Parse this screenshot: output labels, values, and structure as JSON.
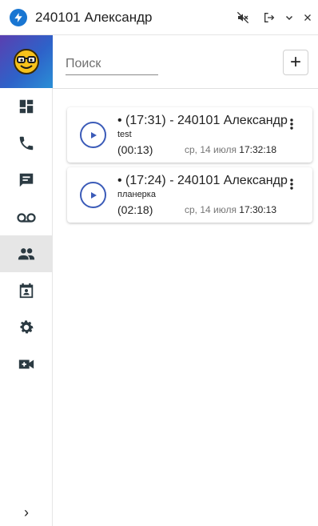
{
  "window": {
    "title": "240101 Александр",
    "icons": [
      "app-bolt-icon",
      "mute-icon",
      "logout-icon",
      "chevron-down-icon",
      "close-icon"
    ]
  },
  "sidebar": {
    "avatar": "glasses-emoji-avatar",
    "items": [
      {
        "icon": "dashboard-icon",
        "active": false
      },
      {
        "icon": "phone-icon",
        "active": false
      },
      {
        "icon": "chat-icon",
        "active": false
      },
      {
        "icon": "voicemail-icon",
        "active": false
      },
      {
        "icon": "people-icon",
        "active": true
      },
      {
        "icon": "calendar-person-icon",
        "active": false
      },
      {
        "icon": "gear-icon",
        "active": false
      },
      {
        "icon": "video-add-icon",
        "active": false
      }
    ],
    "expand_label": "›"
  },
  "main": {
    "search_placeholder": "Поиск",
    "add_label": "+",
    "recordings": [
      {
        "title": "• (17:31) - 240101 Александр",
        "note": "test",
        "duration": "(00:13)",
        "date_prefix": "ср, 14 июля",
        "time": "17:32:18"
      },
      {
        "title": "• (17:24) - 240101 Александр",
        "note": "планерка",
        "duration": "(02:18)",
        "date_prefix": "ср, 14 июля",
        "time": "17:30:13"
      }
    ]
  },
  "colors": {
    "accent": "#3b5bb8",
    "app_icon_bg": "#1976d2",
    "active_nav_bg": "#e6e6e6",
    "icon_color": "#2b3a42"
  }
}
